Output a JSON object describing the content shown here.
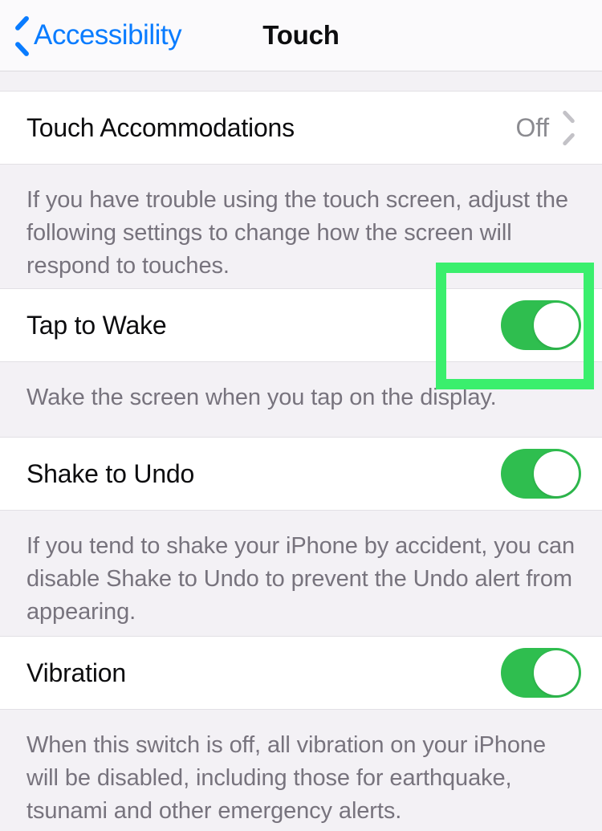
{
  "navbar": {
    "back_label": "Accessibility",
    "title": "Touch",
    "back_icon": "chevron-left-icon",
    "watermark": ""
  },
  "colors": {
    "accent_blue": "#0a7cff",
    "toggle_on_green": "#2fbe4f",
    "highlight_green": "#3aef6d",
    "page_background": "#f3f1f5",
    "row_background": "#ffffff",
    "secondary_text": "#77737d",
    "value_text": "#8b8b90"
  },
  "sections": [
    {
      "id": "touch-accommodations",
      "row": {
        "label": "Touch Accommodations",
        "value": "Off",
        "control": "disclosure",
        "disclosure_icon": "chevron-right-icon"
      },
      "footer": "If you have trouble using the touch screen, adjust the following settings to change how the screen will respond to touches."
    },
    {
      "id": "tap-to-wake",
      "row": {
        "label": "Tap to Wake",
        "value": "On",
        "control": "toggle",
        "toggle_on": true,
        "highlighted": true
      },
      "footer": "Wake the screen when you tap on the display."
    },
    {
      "id": "shake-to-undo",
      "row": {
        "label": "Shake to Undo",
        "value": "On",
        "control": "toggle",
        "toggle_on": true,
        "highlighted": false
      },
      "footer": "If you tend to shake your iPhone by accident, you can disable Shake to Undo to prevent the Undo alert from appearing."
    },
    {
      "id": "vibration",
      "row": {
        "label": "Vibration",
        "value": "On",
        "control": "toggle",
        "toggle_on": true,
        "highlighted": false
      },
      "footer": "When this switch is off, all vibration on your iPhone will be disabled, including those for earthquake, tsunami and other emergency alerts."
    }
  ],
  "annotation": {
    "type": "highlight-rectangle",
    "target": "tap-to-wake-toggle",
    "color": "#3aef6d"
  }
}
